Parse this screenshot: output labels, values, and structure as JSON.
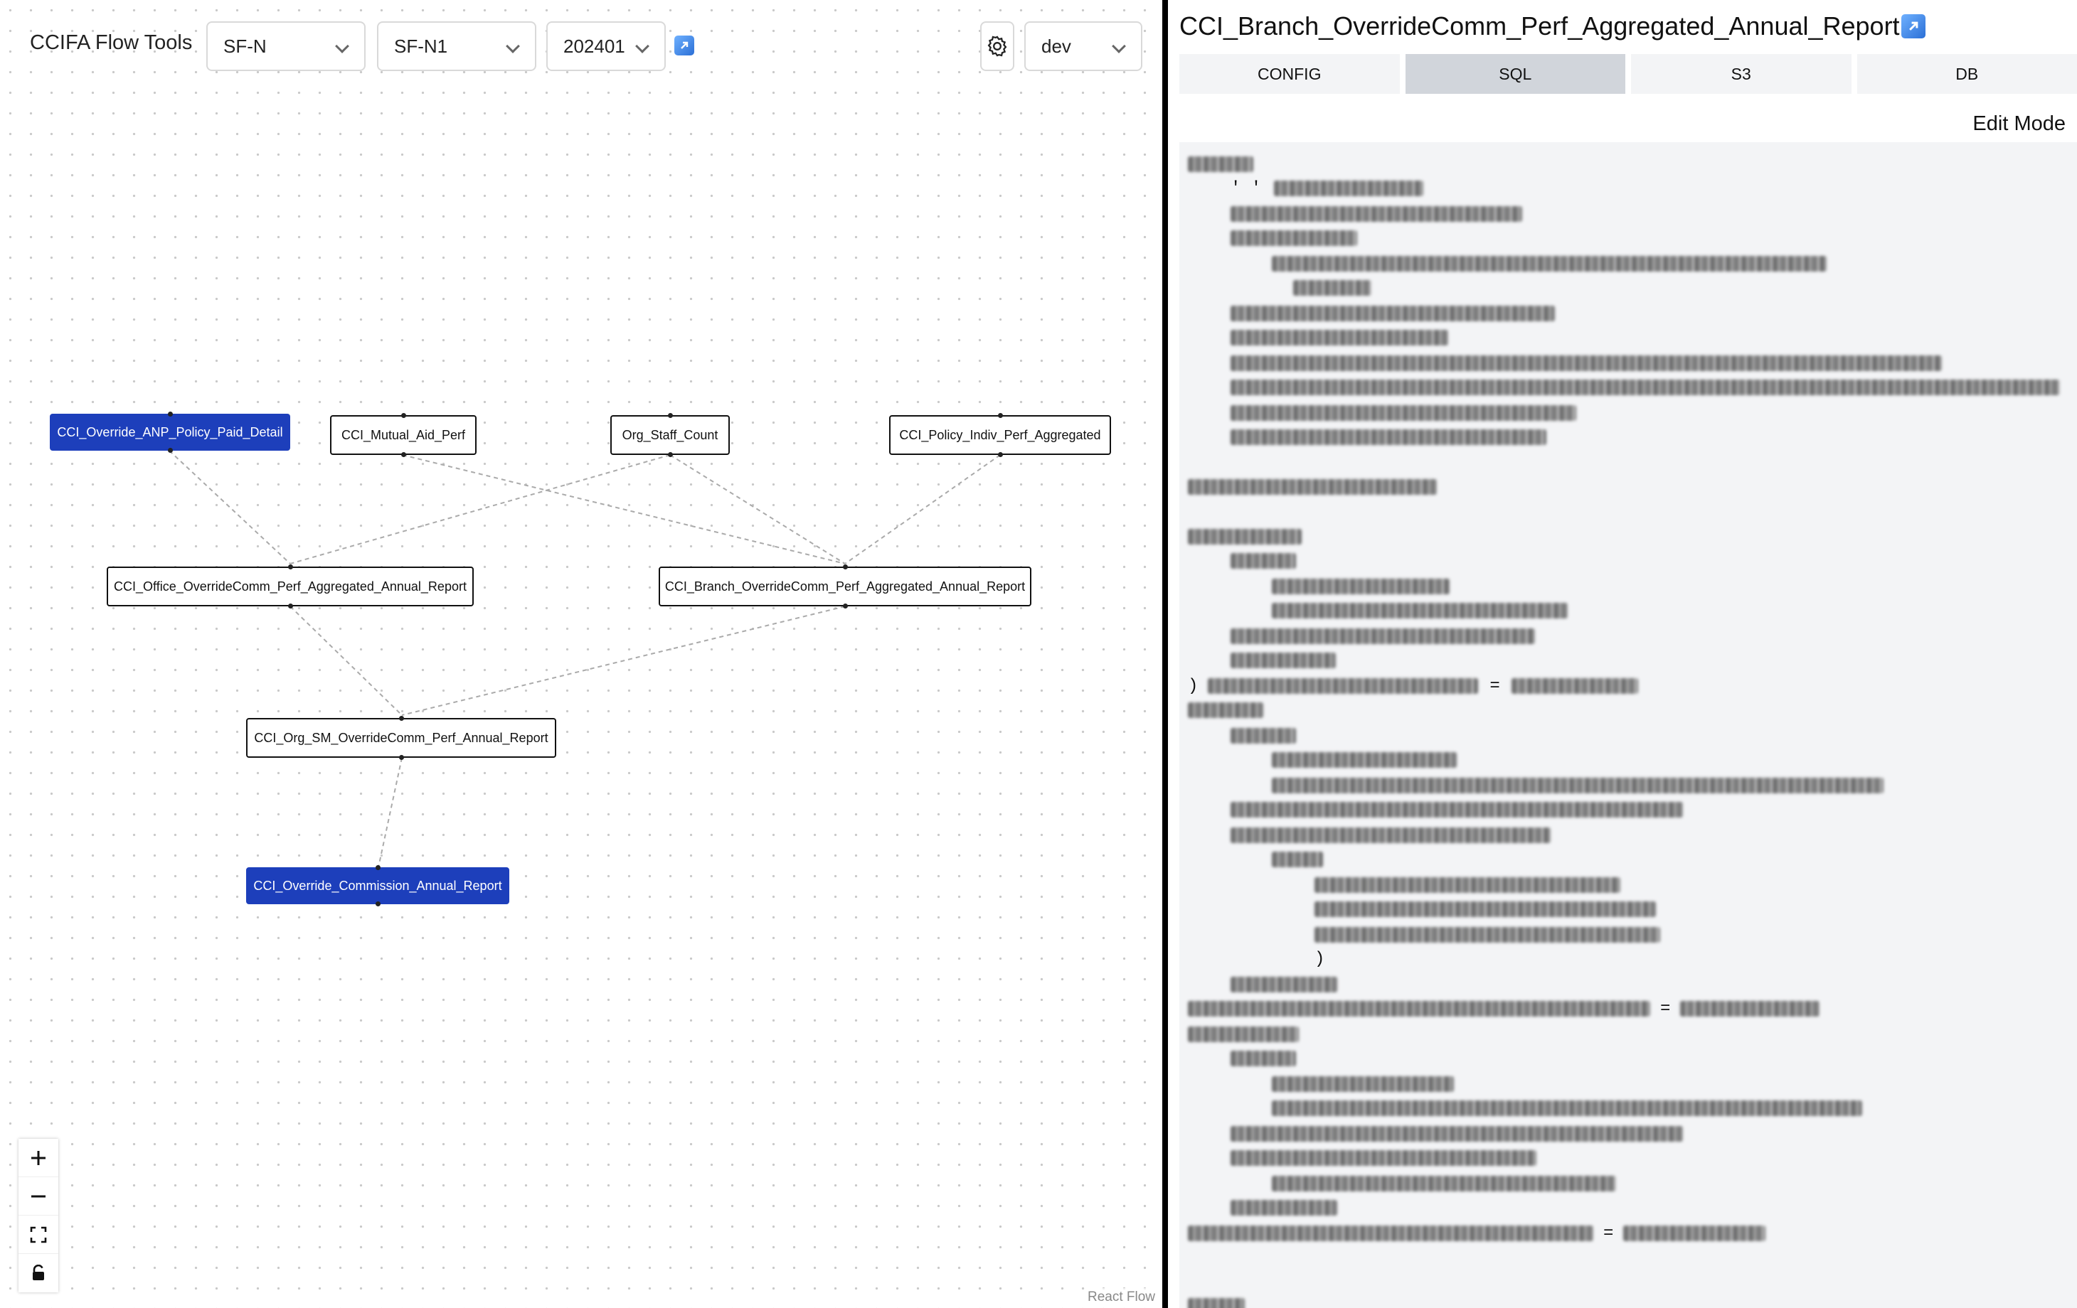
{
  "toolbar": {
    "app_title": "CCIFA Flow Tools",
    "dropdown1": "SF-N",
    "dropdown2": "SF-N1",
    "dropdown3": "202401",
    "env": "dev"
  },
  "flow": {
    "nodes": {
      "n1": "CCI_Override_ANP_Policy_Paid_Detail",
      "n2": "CCI_Mutual_Aid_Perf",
      "n3": "Org_Staff_Count",
      "n4": "CCI_Policy_Indiv_Perf_Aggregated",
      "n5": "CCI_Office_OverrideComm_Perf_Aggregated_Annual_Report",
      "n6": "CCI_Branch_OverrideComm_Perf_Aggregated_Annual_Report",
      "n7": "CCI_Org_SM_OverrideComm_Perf_Annual_Report",
      "n8": "CCI_Override_Commission_Annual_Report"
    },
    "attribution": "React Flow"
  },
  "panel": {
    "title": "CCI_Branch_OverrideComm_Perf_Aggregated_Annual_Report",
    "tabs": [
      "CONFIG",
      "SQL",
      "S3",
      "DB"
    ],
    "active_tab": "SQL",
    "edit_mode": "Edit Mode",
    "code_fragments": {
      "quotes": "' '",
      "paren_close": ")",
      "equals": "="
    }
  },
  "colors": {
    "node_highlight": "#1d3fbb",
    "active_tab": "#d1d5db",
    "code_bg": "#f3f4f6"
  }
}
